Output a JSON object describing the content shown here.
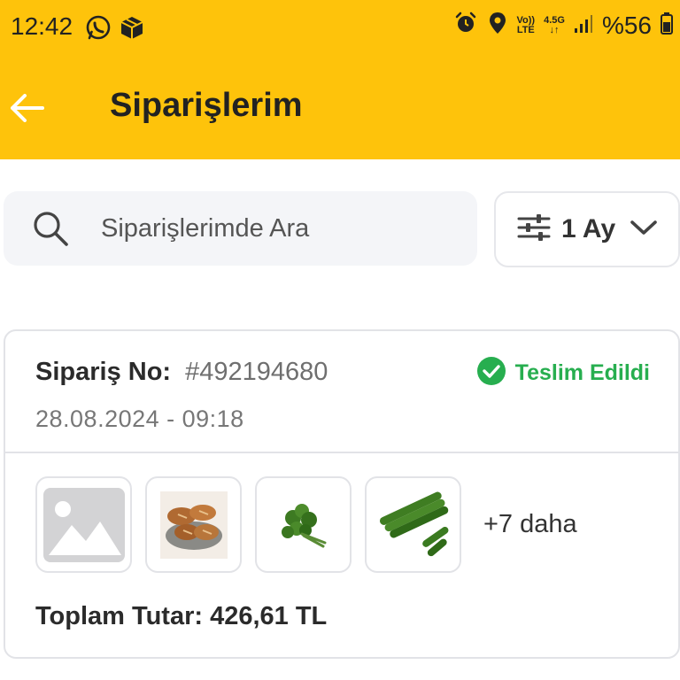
{
  "status_bar": {
    "time": "12:42",
    "battery": "%56",
    "network_top": "4.5G",
    "volte_top": "Vo))",
    "volte_bottom": "LTE"
  },
  "header": {
    "title": "Siparişlerim",
    "back_icon": "arrow-left-icon",
    "background_color": "#FEC30B"
  },
  "search": {
    "placeholder": "Siparişlerimde Ara",
    "icon": "search-icon"
  },
  "filter": {
    "label": "1 Ay",
    "icon": "sliders-icon"
  },
  "order": {
    "number_label": "Sipariş No:",
    "number": "#492194680",
    "status": "Teslim Edildi",
    "status_color": "#27AE4F",
    "date": "28.08.2024 - 09:18",
    "thumbnails": [
      "image-placeholder-icon",
      "bread-image",
      "parsley-image",
      "cucumber-image"
    ],
    "more": "+7 daha",
    "total": "Toplam Tutar: 426,61 TL"
  }
}
